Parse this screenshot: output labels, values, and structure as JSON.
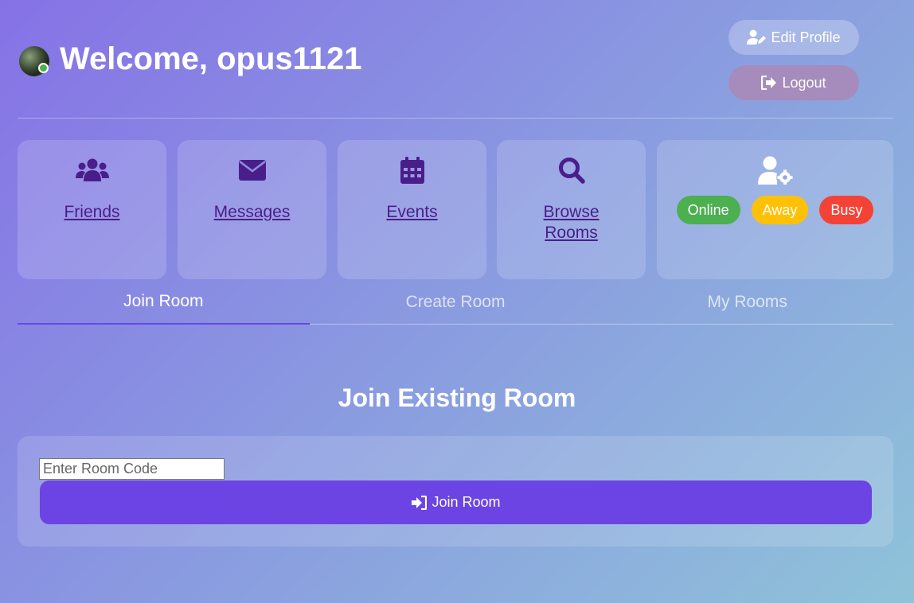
{
  "header": {
    "welcome": "Welcome, opus1121",
    "edit_profile_label": "Edit Profile",
    "logout_label": "Logout"
  },
  "cards": [
    {
      "label": "Friends",
      "icon": "users-icon"
    },
    {
      "label": "Messages",
      "icon": "envelope-icon"
    },
    {
      "label": "Events",
      "icon": "calendar-icon"
    },
    {
      "label": "Browse Rooms",
      "icon": "search-icon"
    }
  ],
  "status": {
    "icon": "user-settings-icon",
    "options": [
      {
        "label": "Online",
        "color": "#4caf50"
      },
      {
        "label": "Away",
        "color": "#ffc107"
      },
      {
        "label": "Busy",
        "color": "#f44336"
      }
    ]
  },
  "tabs": [
    {
      "label": "Join Room",
      "active": true
    },
    {
      "label": "Create Room",
      "active": false
    },
    {
      "label": "My Rooms",
      "active": false
    }
  ],
  "join": {
    "title": "Join Existing Room",
    "input_placeholder": "Enter Room Code",
    "button_label": "Join Room"
  },
  "colors": {
    "accent": "#6c44e3",
    "link": "#4a1e8a",
    "online_dot": "#4caf50"
  }
}
